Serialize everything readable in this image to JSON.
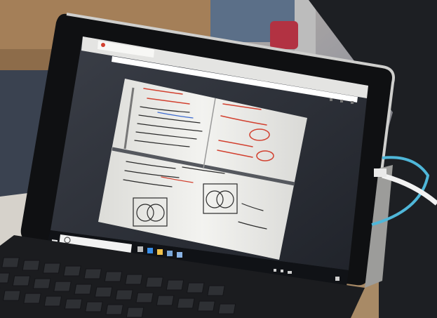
{
  "photo": {
    "subject": "laptop-displaying-whiteboard-photo",
    "colors": {
      "wall": "#d8d2c8",
      "wood": "#8a6a4a",
      "bezel": "#141414",
      "laptop_silver": "#c9c9c7",
      "screen_dark": "#2b2f38",
      "whiteboard": "#efefec",
      "marker_red": "#d2402f",
      "marker_black": "#2a2a2a",
      "marker_blue": "#3b6ad0",
      "keyboard": "#1b1c1f",
      "cable": "#4fb7d9"
    }
  },
  "browser": {
    "tab_title": "",
    "url": ""
  },
  "taskbar": {
    "search_placeholder": "",
    "icons": [
      "start-icon",
      "task-view-icon",
      "edge-icon",
      "explorer-icon",
      "store-icon",
      "mail-icon"
    ],
    "tray_icons": [
      "network-icon",
      "volume-icon",
      "battery-icon"
    ]
  }
}
